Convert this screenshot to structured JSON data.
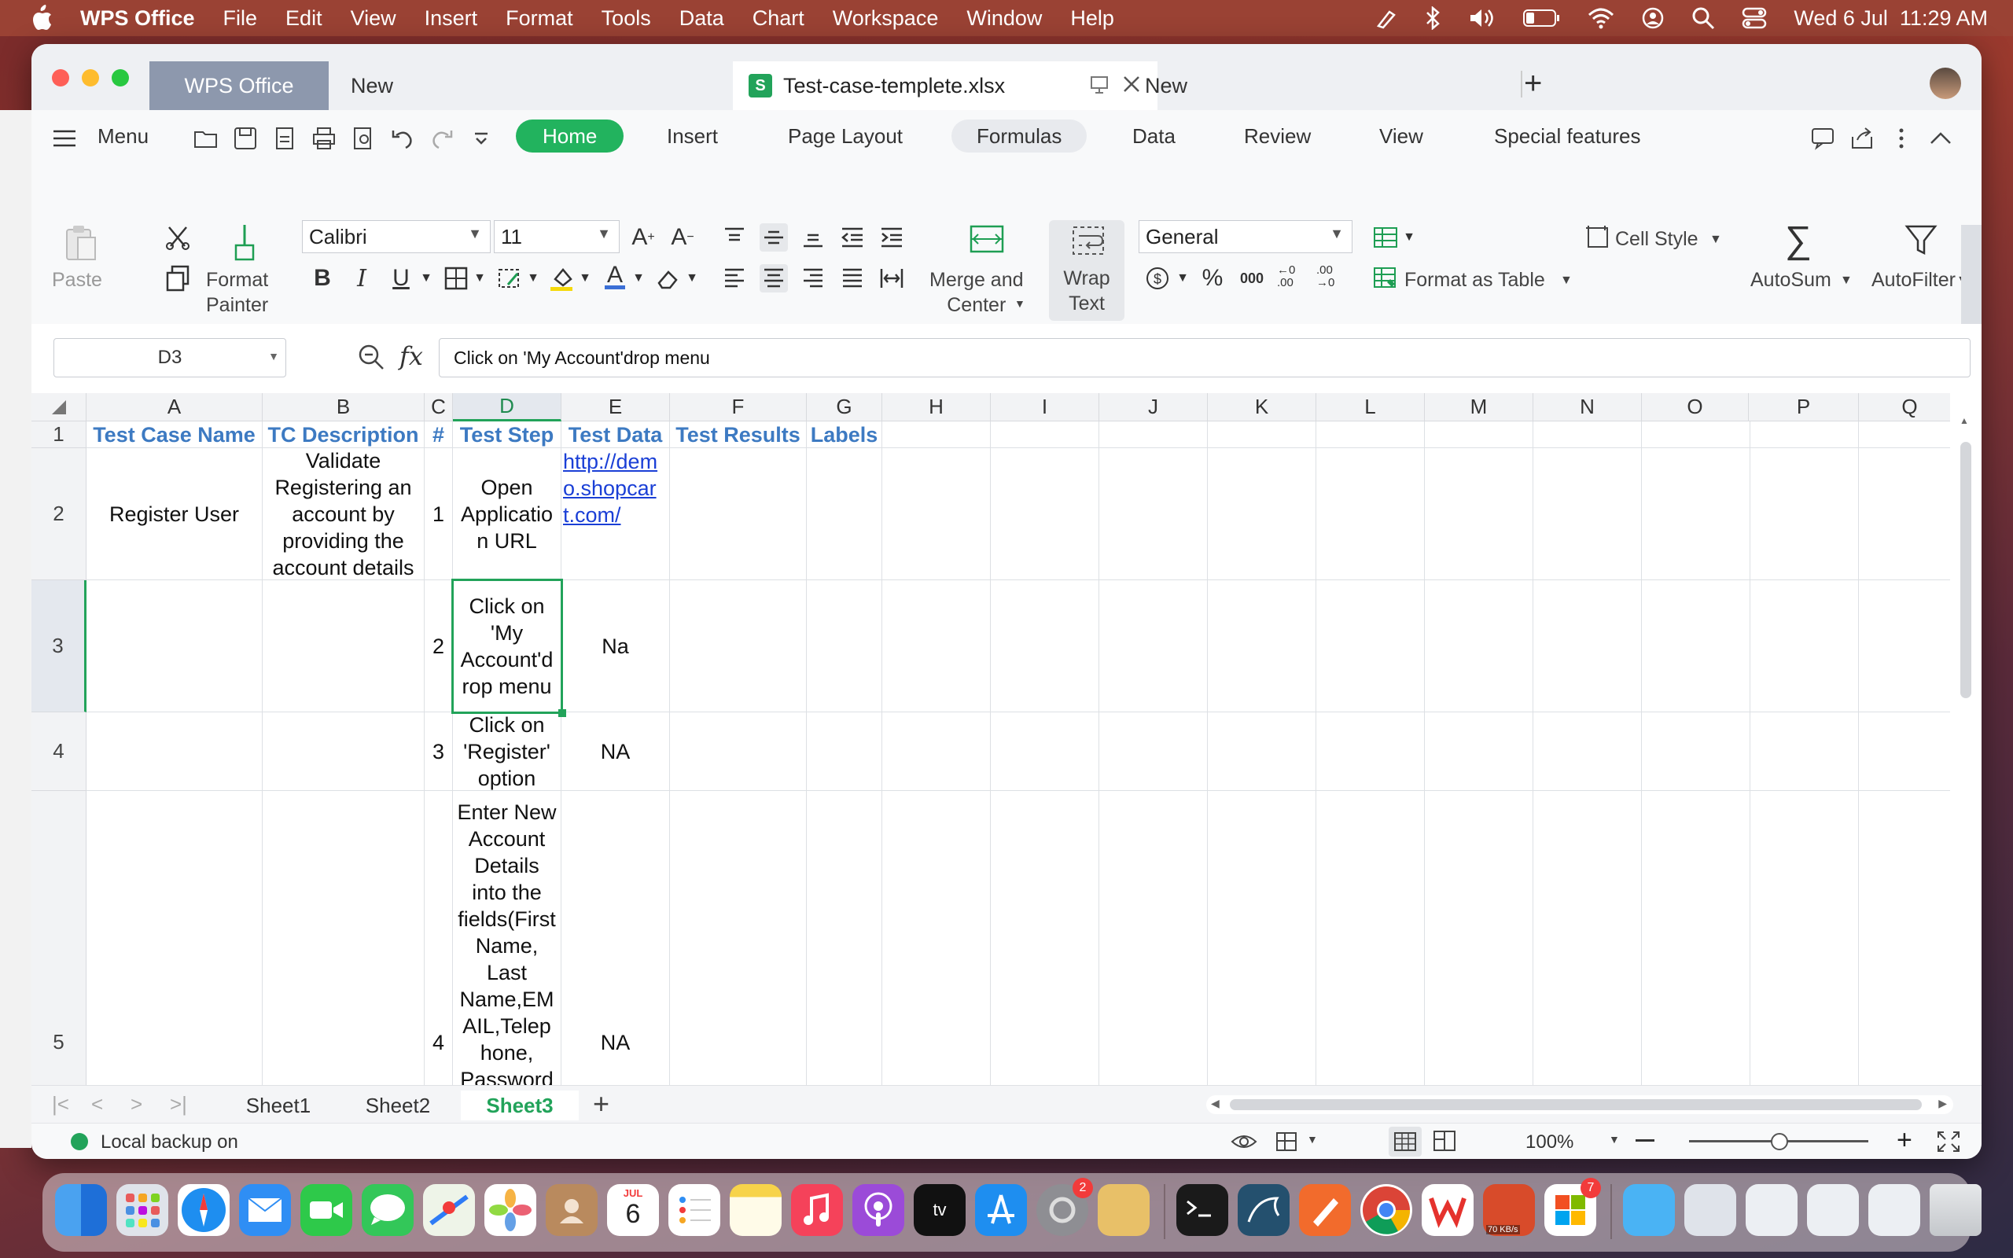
{
  "menubar": {
    "app_name": "WPS Office",
    "items": [
      "File",
      "Edit",
      "View",
      "Insert",
      "Format",
      "Tools",
      "Data",
      "Chart",
      "Workspace",
      "Window",
      "Help"
    ],
    "clock": "Wed 6 Jul  11:29 AM"
  },
  "tabbar": {
    "home_tab": "WPS Office",
    "new_tab_1": "New",
    "doc_tab": "Test-case-templete.xlsx",
    "new_tab_2": "New"
  },
  "ribbon_tabs": {
    "menu": "Menu",
    "tabs": [
      "Home",
      "Insert",
      "Page Layout",
      "Formulas",
      "Data",
      "Review",
      "View",
      "Special features"
    ],
    "active": "Home"
  },
  "ribbon": {
    "paste": "Paste",
    "format_painter": "Format\nPainter",
    "font_name": "Calibri",
    "font_size": "11",
    "merge_center": "Merge and\nCenter",
    "wrap_text": "Wrap\nText",
    "number_format": "General",
    "cell_style": "Cell Style",
    "format_as_table": "Format as Table",
    "autosum": "AutoSum",
    "autofilter": "AutoFilter",
    "thousands": "000",
    "inc_decimal": "←0 .00",
    "dec_decimal": ".00 →0"
  },
  "formula_bar": {
    "name_box": "D3",
    "fx": "fx",
    "content": "Click on 'My Account'drop menu"
  },
  "grid": {
    "columns": [
      "A",
      "B",
      "C",
      "D",
      "E",
      "F",
      "G",
      "H",
      "I",
      "J",
      "K",
      "L",
      "M",
      "N",
      "O",
      "P",
      "Q"
    ],
    "selected_column": "D",
    "rows": [
      "1",
      "2",
      "3",
      "4",
      "5"
    ],
    "selected_row": "3",
    "headers": {
      "A": "Test Case Name",
      "B": "TC Description",
      "C": "#",
      "D": "Test Step",
      "E": "Test Data",
      "F": "Test Results",
      "G": "Labels"
    },
    "r2": {
      "A": "Register User",
      "B": "Validate Registering an account by providing the account details",
      "C": "1",
      "D": "Open Applicatio n URL",
      "E": "http://demo.shopcart.com/"
    },
    "r3": {
      "C": "2",
      "D": "Click on 'My Account'd rop menu",
      "E": "Na"
    },
    "r4": {
      "C": "3",
      "D": "Click on 'Register' option",
      "E": "NA"
    },
    "r5": {
      "C": "4",
      "D": "Enter New Account Details into the fields(First Name, Last Name,EM AIL,Telep hone, Password ,",
      "E": "NA"
    }
  },
  "sheets": {
    "tabs": [
      "Sheet1",
      "Sheet2",
      "Sheet3"
    ],
    "active": "Sheet3"
  },
  "statusbar": {
    "backup": "Local backup on",
    "zoom": "100%"
  },
  "dock": {
    "calendar_month": "JUL",
    "calendar_day": "6",
    "settings_badge": "2",
    "wps_badge": "7",
    "net_speed": "70 KB/s"
  }
}
